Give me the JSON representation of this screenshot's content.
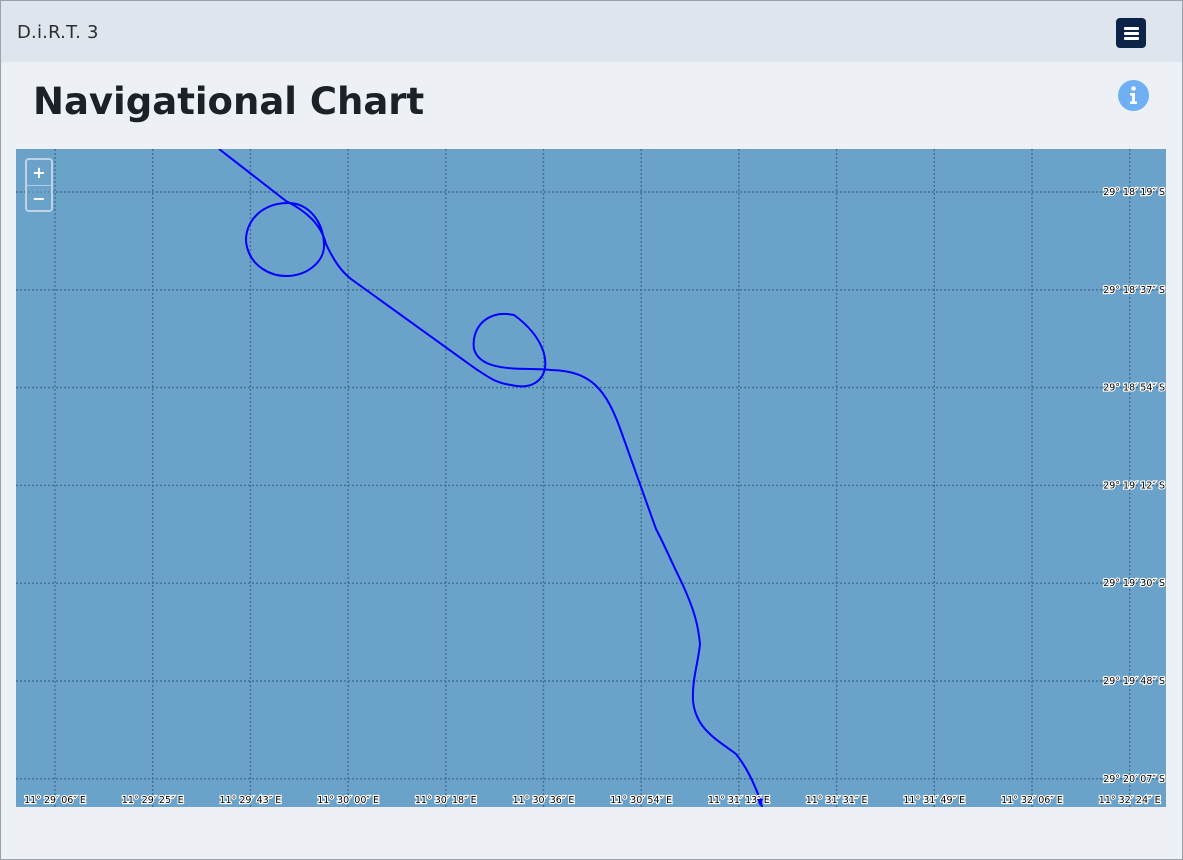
{
  "app": {
    "brand": "D.i.R.T. 3"
  },
  "header": {
    "menu_icon": "hamburger-menu-icon"
  },
  "page": {
    "title": "Navigational Chart",
    "info_icon": "info-circle-icon"
  },
  "map": {
    "zoom_in_label": "+",
    "zoom_out_label": "−",
    "longitude_labels": [
      "11° 29′ 06″ E",
      "11° 29′ 25″ E",
      "11° 29′ 43″ E",
      "11° 30′ 00″ E",
      "11° 30′ 18″ E",
      "11° 30′ 36″ E",
      "11° 30′ 54″ E",
      "11° 31′ 13″ E",
      "11° 31′ 31″ E",
      "11° 31′ 49″ E",
      "11° 32′ 06″ E",
      "11° 32′ 24″ E"
    ],
    "latitude_labels": [
      "29° 18′ 19″ S",
      "29° 18′ 37″ S",
      "29° 18′ 54″ S",
      "29° 19′ 12″ S",
      "29° 19′ 30″ S",
      "29° 19′ 48″ S",
      "29° 20′ 07″ S"
    ],
    "colors": {
      "water": "#6aa2c9",
      "track": "#0000ff",
      "grid": "#42708f"
    }
  }
}
